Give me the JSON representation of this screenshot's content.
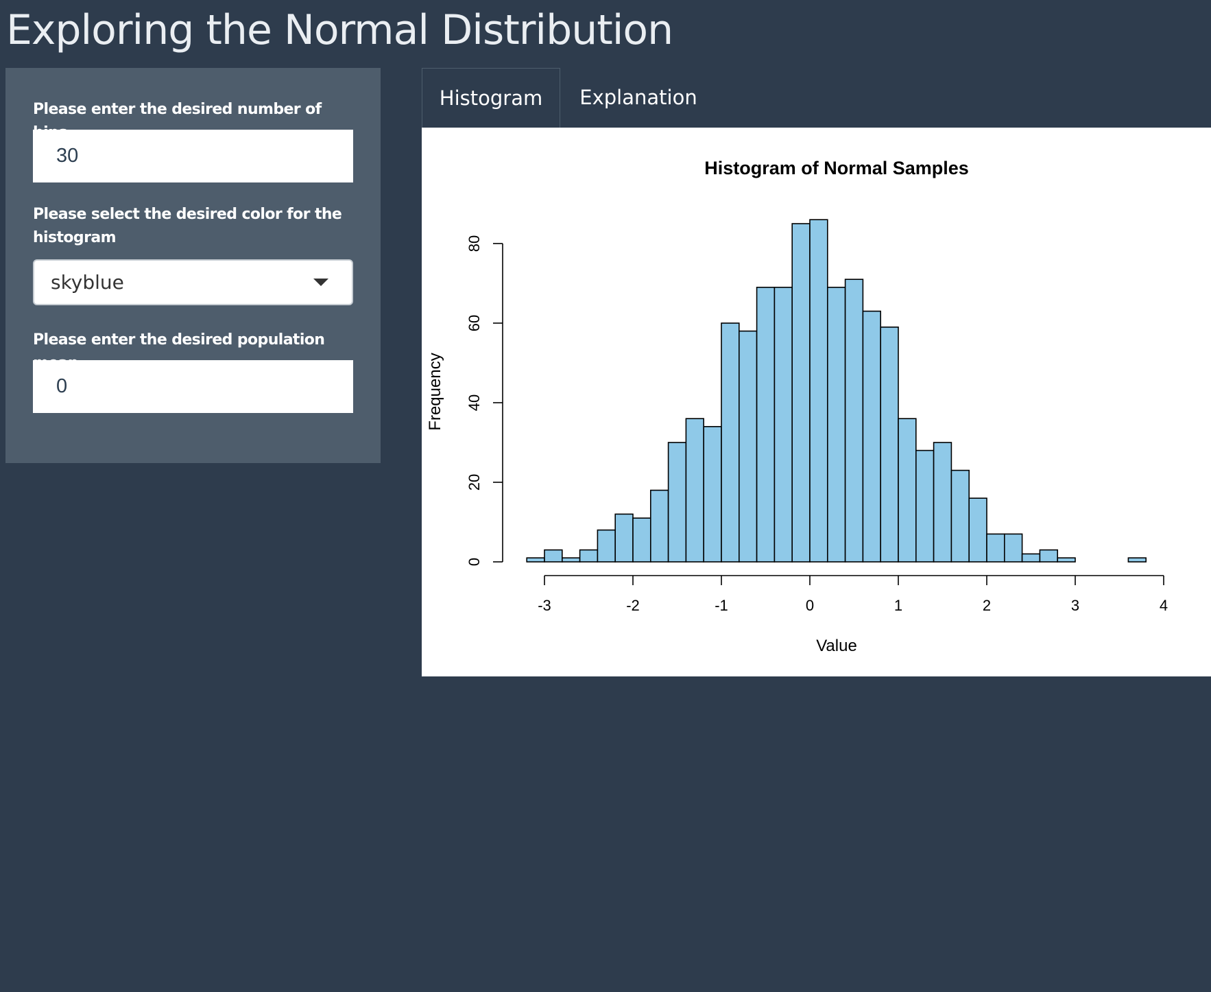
{
  "app": {
    "title": "Exploring the Normal Distribution"
  },
  "sidebar": {
    "bins_label": "Please enter the desired number of bins",
    "bins_value": "30",
    "color_label": "Please select the desired color for the histogram",
    "color_selected": "skyblue",
    "mean_label": "Please enter the desired population mean",
    "mean_value": "0"
  },
  "tabs": [
    {
      "label": "Histogram",
      "active": true
    },
    {
      "label": "Explanation",
      "active": false
    }
  ],
  "colors": {
    "page_background": "#2e3c4d",
    "sidebar_background": "#4e5d6c",
    "bar_fill": "#8fc9e8",
    "bar_outline": "#000000"
  },
  "icons": {
    "select_arrow": "chevron-down-icon"
  },
  "chart_data": {
    "type": "bar",
    "title": "Histogram of Normal Samples",
    "xlabel": "Value",
    "ylabel": "Frequency",
    "bin_width": 0.2,
    "bin_starts": [
      -3.2,
      -3.0,
      -2.8,
      -2.6,
      -2.4,
      -2.2,
      -2.0,
      -1.8,
      -1.6,
      -1.4,
      -1.2,
      -1.0,
      -0.8,
      -0.6,
      -0.4,
      -0.2,
      0.0,
      0.2,
      0.4,
      0.6,
      0.8,
      1.0,
      1.2,
      1.4,
      1.6,
      1.8,
      2.0,
      2.2,
      2.4,
      2.6,
      2.8,
      3.0,
      3.2,
      3.4,
      3.6
    ],
    "values": [
      1,
      3,
      1,
      3,
      8,
      12,
      11,
      18,
      30,
      36,
      34,
      60,
      58,
      69,
      69,
      85,
      86,
      69,
      71,
      63,
      59,
      36,
      28,
      30,
      23,
      16,
      7,
      7,
      2,
      3,
      1,
      0,
      0,
      0,
      1
    ],
    "xlim": [
      -3,
      4
    ],
    "ylim": [
      0,
      80
    ],
    "x_ticks": [
      "-3",
      "-2",
      "-1",
      "0",
      "1",
      "2",
      "3",
      "4"
    ],
    "y_ticks": [
      "0",
      "20",
      "40",
      "60",
      "80"
    ],
    "grid": false,
    "legend": "none"
  }
}
